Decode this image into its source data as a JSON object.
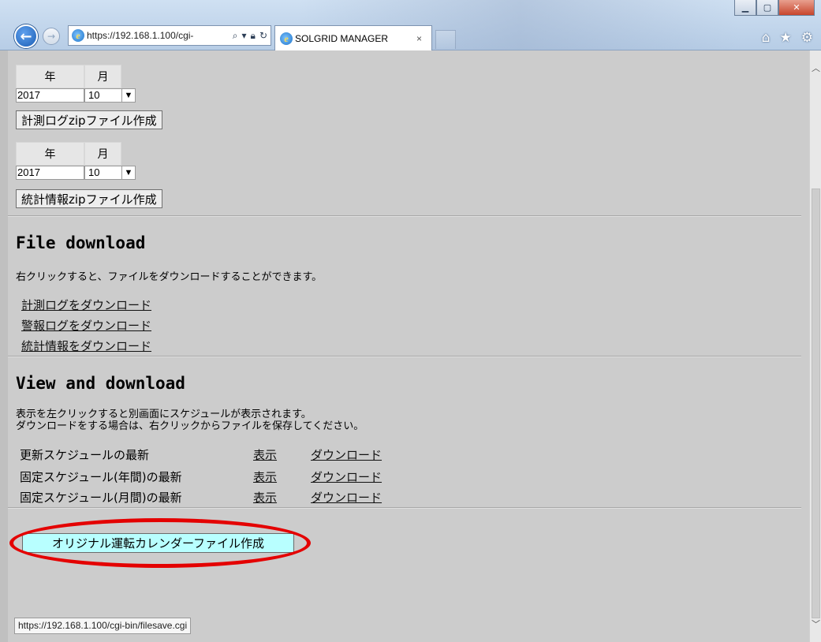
{
  "browser": {
    "url": "https://192.168.1.100/cgi-",
    "tab_title": "SOLGRID MANAGER",
    "tab_close": "×",
    "status_url": "https://192.168.1.100/cgi-bin/filesave.cgi"
  },
  "measure_log": {
    "year_header": "年",
    "month_header": "月",
    "year_value": "2017",
    "month_value": "10",
    "button": "計測ログzipファイル作成"
  },
  "stats": {
    "year_header": "年",
    "month_header": "月",
    "year_value": "2017",
    "month_value": "10",
    "button": "統計情報zipファイル作成"
  },
  "file_download": {
    "heading": "File download",
    "description": "右クリックすると、ファイルをダウンロードすることができます。",
    "links": [
      "計測ログをダウンロード",
      "警報ログをダウンロード",
      "統計情報をダウンロード"
    ]
  },
  "view_download": {
    "heading": "View and download",
    "description_line1": "表示を左クリックすると別画面にスケジュールが表示されます。",
    "description_line2": "ダウンロードをする場合は、右クリックからファイルを保存してください。",
    "rows": [
      {
        "label": "更新スケジュールの最新",
        "view": "表示",
        "download": "ダウンロード"
      },
      {
        "label": "固定スケジュール(年間)の最新",
        "view": "表示",
        "download": "ダウンロード"
      },
      {
        "label": "固定スケジュール(月間)の最新",
        "view": "表示",
        "download": "ダウンロード"
      }
    ]
  },
  "calendar_button": "オリジナル運転カレンダーファイル作成",
  "colors": {
    "page_background": "#cccccc",
    "calendar_button_bg": "#b8ffff",
    "highlight_ellipse": "#e40000"
  }
}
